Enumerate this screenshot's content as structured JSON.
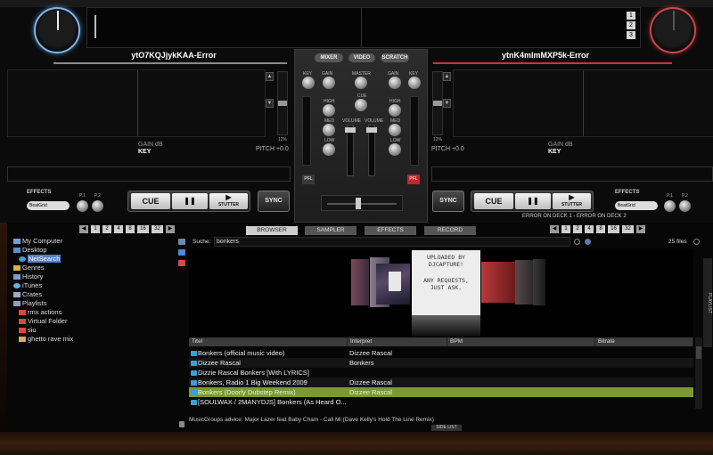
{
  "deck_left": {
    "title": "ytO7KQJjykKAA-Error",
    "gain": "GAIN dB",
    "key": "KEY",
    "pitch": "PITCH +0.0",
    "pitch_range": "12%",
    "effects_label": "EFFECTS",
    "effect_select": "BeatGrid",
    "knob1": "P.1",
    "knob2": "P.2",
    "cue": "CUE",
    "pause": "❚❚",
    "play": "▶",
    "stutter": "STUTTER",
    "sync": "SYNC",
    "pages": [
      "1",
      "2",
      "4",
      "8",
      "16",
      "32"
    ]
  },
  "deck_right": {
    "title": "ytnK4mlmMXP5k-Error",
    "gain": "GAIN dB",
    "key": "KEY",
    "pitch": "PITCH +0.0",
    "pitch_range": "12%",
    "effects_label": "EFFECTS",
    "effect_select": "BeatGrid",
    "knob1": "P.1",
    "knob2": "P.2",
    "cue": "CUE",
    "pause": "❚❚",
    "play": "▶",
    "stutter": "STUTTER",
    "sync": "SYNC",
    "pages": [
      "1",
      "2",
      "4",
      "8",
      "16",
      "32"
    ],
    "error_text": "ERROR ON DECK 1 - ERROR ON DECK 2"
  },
  "deck_numbers": [
    "1",
    "2",
    "3"
  ],
  "mixer": {
    "tabs": [
      "MIXER",
      "VIDEO",
      "SCRATCH"
    ],
    "key": "KEY",
    "gain": "GAIN",
    "master": "MASTER",
    "cue": "CUE",
    "high": "HIGH",
    "med": "MED",
    "low": "LOW",
    "volume": "VOLUME",
    "pfl": "PFL"
  },
  "browser": {
    "tabs": [
      "BROWSER",
      "SAMPLER",
      "EFFECTS",
      "RECORD"
    ],
    "tree": [
      {
        "label": "My Computer"
      },
      {
        "label": "Desktop"
      },
      {
        "label": "NetSearch"
      },
      {
        "label": "Genres"
      },
      {
        "label": "History"
      },
      {
        "label": "iTunes"
      },
      {
        "label": "Crates"
      },
      {
        "label": "Playlists"
      },
      {
        "label": "rmx actions"
      },
      {
        "label": "Virtual Folder"
      },
      {
        "label": "siu"
      },
      {
        "label": "ghetto rave mix"
      }
    ],
    "search_label": "Suche:",
    "search_value": "bonkers",
    "files_count": "25 files",
    "cover_text": [
      "UPLOADED BY",
      "DJCAPTURE!",
      "",
      "ANY REQUESTS,",
      "JUST ASK."
    ],
    "columns": [
      "Titel",
      "Interpret",
      "BPM",
      "Bitrate"
    ],
    "tracks": [
      {
        "title": "Bonkers (official music video)",
        "artist": "Dizzee Rascal"
      },
      {
        "title": "Dizzee Rascal",
        "artist": "Bonkers"
      },
      {
        "title": "Dizzie Rascal Bonkers [With LYRICS]",
        "artist": ""
      },
      {
        "title": "Bonkers, Radio 1 Big Weekend 2009",
        "artist": "Dizzee Rascal"
      },
      {
        "title": "Bonkers (Doorly Dubstep Remix)",
        "artist": "Dizzee Rascal"
      },
      {
        "title": "[SOULWAX / 2MANYDJS] Bonkers (As Heard O...",
        "artist": ""
      }
    ],
    "advice": "MusicGroups advice: Major Lazer feat Baby Cham - Call Mi (Dave Kelly's Hold The Line Remix)",
    "side_list": "SIDE LIST",
    "playlist_tab": "PLAYLIST"
  },
  "colors": {
    "left_accent": "#7fb6e8",
    "right_accent": "#c0393b",
    "selected_row": "#7a9a2e",
    "tree_selection": "#4f7ec8"
  }
}
